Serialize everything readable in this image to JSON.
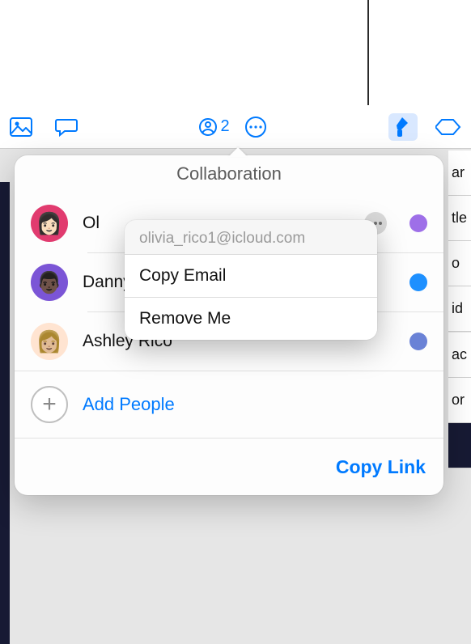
{
  "toolbar": {
    "collab_count": "2"
  },
  "sheet": {
    "title": "Collaboration",
    "participants": [
      {
        "name": "Olivia Rico",
        "name_truncated": "Ol",
        "avatar_bg": "#e13b6f",
        "avatar_emoji": "👩🏻",
        "status_color": "#9e6fe8",
        "has_more": true
      },
      {
        "name": "Danny Rico (Owner)",
        "avatar_bg": "#7b55d6",
        "avatar_emoji": "👨🏿",
        "status_color": "#1e90ff",
        "has_more": false
      },
      {
        "name": "Ashley Rico",
        "avatar_bg": "#ffe4d1",
        "avatar_emoji": "👩🏼",
        "status_color": "#6a82d6",
        "has_more": false
      }
    ],
    "add_people_label": "Add People",
    "copy_link_label": "Copy Link"
  },
  "context_menu": {
    "email": "olivia_rico1@icloud.com",
    "items": [
      {
        "label": "Copy Email"
      },
      {
        "label": "Remove Me"
      }
    ]
  },
  "bg_cells": {
    "a": "ar",
    "b": "tle",
    "c": "o",
    "d": "id",
    "e": "ac",
    "f": "or"
  }
}
